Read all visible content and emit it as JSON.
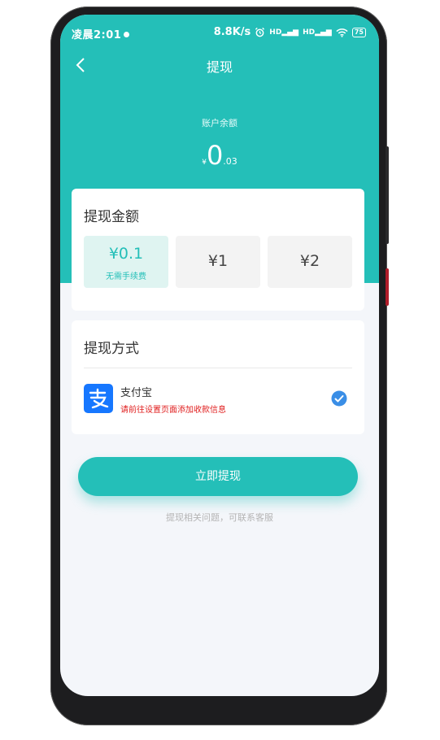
{
  "status_bar": {
    "time": "凌晨2:01",
    "network_speed": "8.8K/s",
    "signal_1": "HD",
    "signal_2": "HD",
    "battery": "75"
  },
  "nav": {
    "title": "提现"
  },
  "balance": {
    "label": "账户余额",
    "currency": "¥",
    "integer": "0",
    "decimal": ".03"
  },
  "amount_card": {
    "title": "提现金额",
    "options": [
      {
        "amount": "¥0.1",
        "note": "无需手续费",
        "selected": true
      },
      {
        "amount": "¥1",
        "selected": false
      },
      {
        "amount": "¥2",
        "selected": false
      }
    ]
  },
  "method_card": {
    "title": "提现方式",
    "method": {
      "icon": "alipay-icon",
      "name": "支付宝",
      "tip": "请前往设置页面添加收款信息",
      "checked": true
    }
  },
  "submit_label": "立即提现",
  "help_text": "提现相关问题，可联系客服",
  "colors": {
    "accent": "#24bfb8",
    "selected_bg": "#dff4f1",
    "warning": "#e02020",
    "alipay": "#1677ff",
    "check": "#3a8ee6"
  }
}
